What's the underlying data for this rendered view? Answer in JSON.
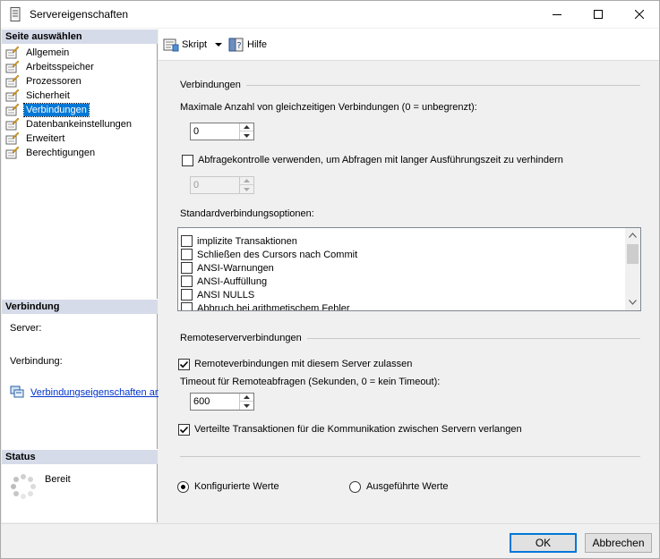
{
  "window": {
    "title": "Servereigenschaften"
  },
  "left": {
    "select_page_header": "Seite auswählen",
    "pages": [
      {
        "label": "Allgemein"
      },
      {
        "label": "Arbeitsspeicher"
      },
      {
        "label": "Prozessoren"
      },
      {
        "label": "Sicherheit"
      },
      {
        "label": "Verbindungen",
        "selected": true
      },
      {
        "label": "Datenbankeinstellungen"
      },
      {
        "label": "Erweitert"
      },
      {
        "label": "Berechtigungen"
      }
    ],
    "connection_header": "Verbindung",
    "server_label": "Server:",
    "connection_label": "Verbindung:",
    "connection_props_link": "Verbindungseigenschaften an:",
    "status_header": "Status",
    "status_text": "Bereit"
  },
  "toolbar": {
    "script_label": "Skript",
    "help_label": "Hilfe"
  },
  "connections": {
    "group_title": "Verbindungen",
    "max_connections_label": "Maximale Anzahl von gleichzeitigen Verbindungen (0 = unbegrenzt):",
    "max_connections_value": "0",
    "query_governor_label": "Abfragekontrolle verwenden, um Abfragen mit langer Ausführungszeit zu verhindern",
    "query_governor_checked": false,
    "query_governor_value": "0",
    "default_options_label": "Standardverbindungsoptionen:",
    "default_options": [
      {
        "label": "implizite Transaktionen",
        "checked": false
      },
      {
        "label": "Schließen des Cursors nach Commit",
        "checked": false
      },
      {
        "label": "ANSI-Warnungen",
        "checked": false
      },
      {
        "label": "ANSI-Auffüllung",
        "checked": false
      },
      {
        "label": "ANSI NULLS",
        "checked": false
      },
      {
        "label": "Abbruch bei arithmetischem Fehler",
        "checked": false
      }
    ]
  },
  "remote": {
    "group_title": "Remoteserververbindungen",
    "allow_remote_label": "Remoteverbindungen mit diesem Server zulassen",
    "allow_remote_checked": true,
    "timeout_label": "Timeout für Remoteabfragen (Sekunden, 0 = kein Timeout):",
    "timeout_value": "600",
    "distributed_label": "Verteilte Transaktionen für die Kommunikation zwischen Servern verlangen",
    "distributed_checked": true
  },
  "values_mode": {
    "configured_label": "Konfigurierte Werte",
    "running_label": "Ausgeführte Werte",
    "selected": "configured"
  },
  "footer": {
    "ok_label": "OK",
    "cancel_label": "Abbrechen"
  }
}
